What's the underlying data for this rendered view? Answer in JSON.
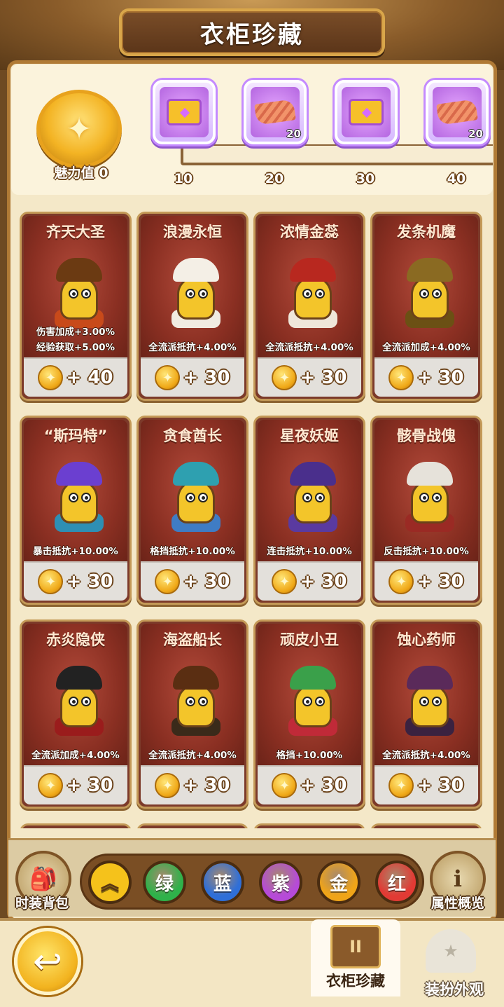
{
  "header": {
    "title": "衣柜珍藏"
  },
  "charm": {
    "label": "魅力值 0",
    "icon": "star-medal-icon"
  },
  "rewards": [
    {
      "icon": "treasure-chest-icon",
      "count": "",
      "threshold": "10"
    },
    {
      "icon": "cloth-material-icon",
      "count": "20",
      "threshold": "20"
    },
    {
      "icon": "treasure-chest-icon",
      "count": "",
      "threshold": "30"
    },
    {
      "icon": "cloth-material-icon",
      "count": "20",
      "threshold": "40"
    }
  ],
  "costumes": [
    {
      "name": "齐天大圣",
      "stats": [
        "伤害加成+3.00%",
        "经验获取+5.00%"
      ],
      "price": "+ 40",
      "hat": "#6b3a12",
      "robe": "#c84a1a"
    },
    {
      "name": "浪漫永恒",
      "stats": [
        "全流派抵抗+4.00%"
      ],
      "price": "+ 30",
      "hat": "#f4efe6",
      "robe": "#f1ece2"
    },
    {
      "name": "浓情金蕊",
      "stats": [
        "全流派抵抗+4.00%"
      ],
      "price": "+ 30",
      "hat": "#b8281f",
      "robe": "#efe7da"
    },
    {
      "name": "发条机魔",
      "stats": [
        "全流派加成+4.00%"
      ],
      "price": "+ 30",
      "hat": "#8a6a22",
      "robe": "#6b5014"
    },
    {
      "name": "“斯玛特”",
      "stats": [
        "暴击抵抗+10.00%"
      ],
      "price": "+ 30",
      "hat": "#6b3fd0",
      "robe": "#2e8fb4"
    },
    {
      "name": "贪食酋长",
      "stats": [
        "格挡抵抗+10.00%"
      ],
      "price": "+ 30",
      "hat": "#2ea0b0",
      "robe": "#3f7cc4"
    },
    {
      "name": "星夜妖姬",
      "stats": [
        "连击抵抗+10.00%"
      ],
      "price": "+ 30",
      "hat": "#4a2f8c",
      "robe": "#5a3aa0"
    },
    {
      "name": "骸骨战傀",
      "stats": [
        "反击抵抗+10.00%"
      ],
      "price": "+ 30",
      "hat": "#e6e2da",
      "robe": "#9a2a24"
    },
    {
      "name": "赤炎隐侠",
      "stats": [
        "全流派加成+4.00%"
      ],
      "price": "+ 30",
      "hat": "#222222",
      "robe": "#9a1c1c"
    },
    {
      "name": "海盗船长",
      "stats": [
        "全流派抵抗+4.00%"
      ],
      "price": "+ 30",
      "hat": "#5a2e12",
      "robe": "#3a2a1a"
    },
    {
      "name": "顽皮小丑",
      "stats": [
        "格挡+10.00%"
      ],
      "price": "+ 30",
      "hat": "#3aa04a",
      "robe": "#c02a38"
    },
    {
      "name": "蚀心药师",
      "stats": [
        "全流派抵抗+4.00%"
      ],
      "price": "+ 30",
      "hat": "#5a2a5a",
      "robe": "#3a2240"
    }
  ],
  "filters": {
    "expand_icon": "double-chevron-up-icon",
    "labels": [
      "绿",
      "蓝",
      "紫",
      "金",
      "红"
    ],
    "colors": [
      "#2fb24a",
      "#2f6fd8",
      "#b64ad8",
      "#f0a418",
      "#e23a34"
    ],
    "expand_color": "#f5c21b"
  },
  "left_button": {
    "label": "时装背包",
    "icon": "backpack-icon"
  },
  "right_button": {
    "label": "属性概览",
    "icon": "scroll-info-icon"
  },
  "bottom_tabs": [
    {
      "label": "衣柜珍藏",
      "icon": "wardrobe-icon",
      "active": true
    },
    {
      "label": "装扮外观",
      "icon": "hat-icon",
      "active": false
    }
  ],
  "back_button": {
    "icon": "back-arrow-icon"
  }
}
